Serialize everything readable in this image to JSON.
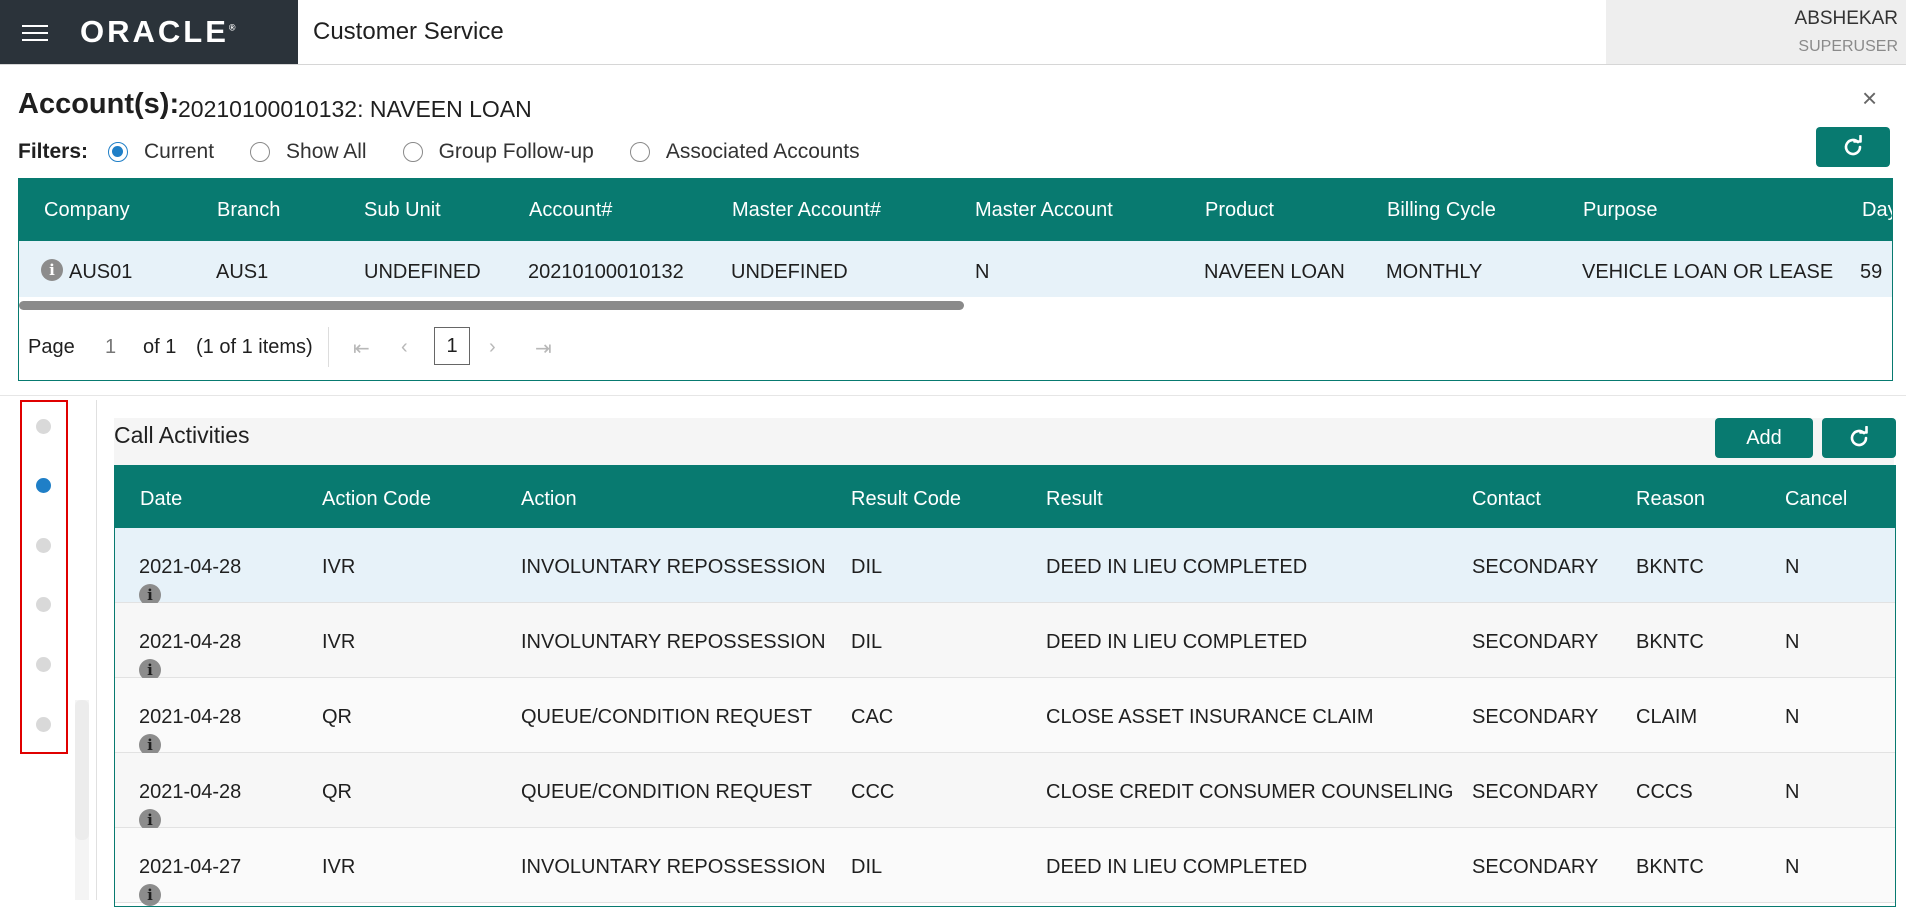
{
  "header": {
    "logo": "ORACLE",
    "app_title": "Customer Service",
    "user_name": "ABSHEKAR",
    "user_role": "SUPERUSER"
  },
  "account": {
    "label": "Account(s):",
    "value": "20210100010132: NAVEEN LOAN",
    "close": "×"
  },
  "filters": {
    "label": "Filters:",
    "options": [
      "Current",
      "Show All",
      "Group Follow-up",
      "Associated Accounts"
    ],
    "selected": "Current"
  },
  "accounts_grid": {
    "columns": [
      "Company",
      "Branch",
      "Sub Unit",
      "Account#",
      "Master Account#",
      "Master Account",
      "Product",
      "Billing Cycle",
      "Purpose",
      "Day"
    ],
    "row": [
      "AUS01",
      "AUS1",
      "UNDEFINED",
      "20210100010132",
      "UNDEFINED",
      "N",
      "NAVEEN LOAN",
      "MONTHLY",
      "VEHICLE LOAN OR LEASE",
      "59"
    ]
  },
  "pager": {
    "page_label": "Page",
    "page_value": "1",
    "of_label": "of 1",
    "items_label": "(1 of 1 items)",
    "current": "1"
  },
  "call_activities": {
    "title": "Call Activities",
    "add_label": "Add",
    "columns": [
      "Date",
      "Action Code",
      "Action",
      "Result Code",
      "Result",
      "Contact",
      "Reason",
      "Cancel"
    ],
    "rows": [
      [
        "2021-04-28",
        "IVR",
        "INVOLUNTARY REPOSSESSION",
        "DIL",
        "DEED IN LIEU COMPLETED",
        "SECONDARY",
        "BKNTC",
        "N"
      ],
      [
        "2021-04-28",
        "IVR",
        "INVOLUNTARY REPOSSESSION",
        "DIL",
        "DEED IN LIEU COMPLETED",
        "SECONDARY",
        "BKNTC",
        "N"
      ],
      [
        "2021-04-28",
        "QR",
        "QUEUE/CONDITION REQUEST",
        "CAC",
        "CLOSE ASSET INSURANCE CLAIM",
        "SECONDARY",
        "CLAIM",
        "N"
      ],
      [
        "2021-04-28",
        "QR",
        "QUEUE/CONDITION REQUEST",
        "CCC",
        "CLOSE CREDIT CONSUMER COUNSELING",
        "SECONDARY",
        "CCCS",
        "N"
      ],
      [
        "2021-04-27",
        "IVR",
        "INVOLUNTARY REPOSSESSION",
        "DIL",
        "DEED IN LIEU COMPLETED",
        "SECONDARY",
        "BKNTC",
        "N"
      ]
    ]
  },
  "colors": {
    "accent": "#087a70",
    "header_dark": "#2b333a",
    "selected_row": "#e7f2f9",
    "active_dot": "#1f7fc7"
  }
}
